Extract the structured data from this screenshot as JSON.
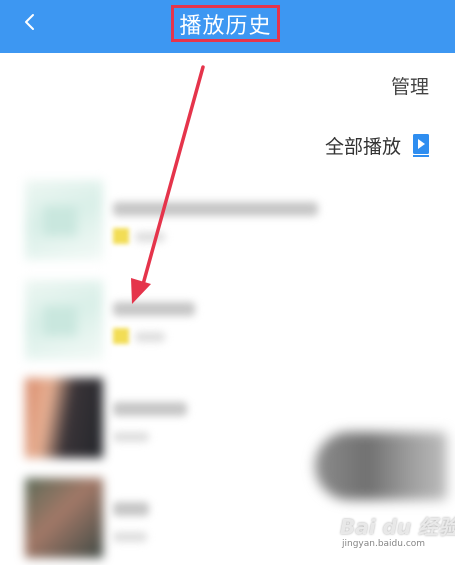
{
  "header": {
    "back_icon": "chevron-left-icon",
    "title": "播放历史",
    "background_color": "#3d97f2",
    "highlight_color": "#e5344b"
  },
  "toolbar": {
    "manage_label": "管理",
    "play_all_label": "全部播放",
    "play_all_icon": "play-list-icon",
    "accent_color": "#2f8ef0"
  },
  "history_items": [
    {
      "thumbnail": "blurred-light-cover"
    },
    {
      "thumbnail": "blurred-light-cover"
    },
    {
      "thumbnail": "blurred-dark-cover"
    },
    {
      "thumbnail": "blurred-photo-cover"
    }
  ],
  "annotation": {
    "arrow_color": "#e5344b"
  },
  "watermark": {
    "brand": "Bai du 经验",
    "url": "jingyan.baidu.com"
  }
}
